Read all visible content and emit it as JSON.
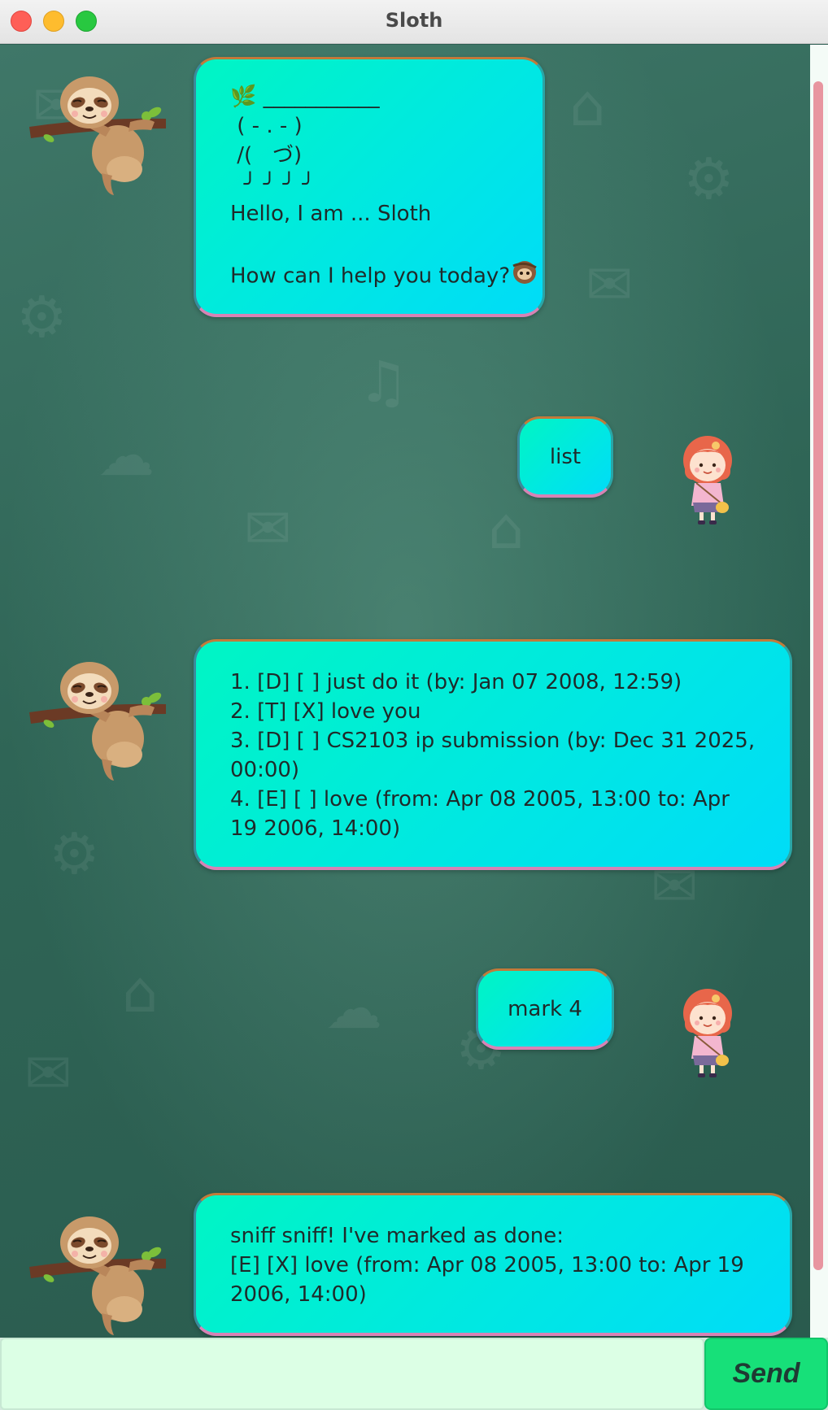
{
  "window": {
    "title": "Sloth"
  },
  "messages": [
    {
      "sender": "bot",
      "lines": [
        "🌿 ___________",
        " ( - . - )",
        " /(   づ)",
        "  ╯ ╯ ╯ ╯",
        "Hello, I am ... Sloth",
        "",
        "How can I help you today?"
      ]
    },
    {
      "sender": "user",
      "text": "list"
    },
    {
      "sender": "bot",
      "lines": [
        "1. [D] [ ] just do it (by: Jan 07 2008, 12:59)",
        "2. [T] [X] love you",
        "3. [D] [ ] CS2103 ip submission (by: Dec 31 2025, 00:00)",
        "4. [E] [ ] love (from: Apr 08 2005, 13:00 to: Apr 19 2006, 14:00)"
      ]
    },
    {
      "sender": "user",
      "text": "mark 4"
    },
    {
      "sender": "bot",
      "lines": [
        "sniff sniff! I've marked as done:",
        "[E] [X] love (from: Apr 08 2005, 13:00 to: Apr 19 2006, 14:00)"
      ]
    }
  ],
  "input": {
    "value": "",
    "placeholder": ""
  },
  "send_button": {
    "label": "Send"
  },
  "colors": {
    "bubble_start": "#00f5c4",
    "bubble_end": "#00dcf8",
    "send_button": "#17e079",
    "input_bg": "#dcffe5",
    "scrollbar_thumb": "#e895a0"
  },
  "icons": [
    "sloth-avatar-icon",
    "girl-avatar-icon",
    "leaf-icon",
    "sloth-emoji-icon"
  ]
}
